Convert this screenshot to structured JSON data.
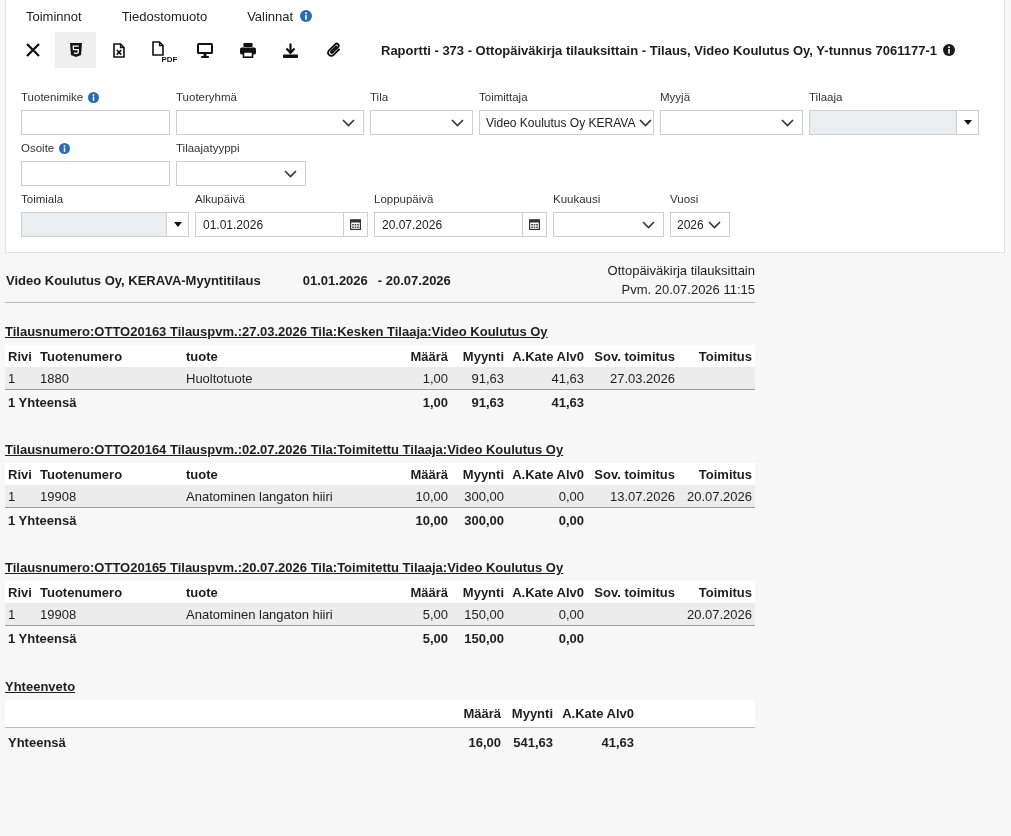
{
  "menu": [
    {
      "label": "Toiminnot",
      "info": false
    },
    {
      "label": "Tiedostomuoto",
      "info": false
    },
    {
      "label": "Valinnat",
      "info": true
    }
  ],
  "toolbar": [
    {
      "kind": "close",
      "selected": false
    },
    {
      "kind": "html",
      "selected": true
    },
    {
      "kind": "sheet",
      "selected": false
    },
    {
      "kind": "pdf",
      "label": "PDF",
      "selected": false
    },
    {
      "kind": "screen",
      "selected": false
    },
    {
      "kind": "print",
      "selected": false
    },
    {
      "kind": "download",
      "selected": false
    },
    {
      "kind": "attach",
      "selected": false
    }
  ],
  "report_title": {
    "text": "Raportti - 373 - Ottopäiväkirja tilauksittain - Tilaus, Video Koulutus Oy, Y-tunnus 7061177-1",
    "info": true
  },
  "filters": {
    "rows": [
      {
        "fields": [
          {
            "label": "Tuotenimike",
            "info": true,
            "kind": "text",
            "disabled": false
          },
          {
            "label": "Tuoteryhmä",
            "info": false,
            "kind": "select",
            "disabled": false
          },
          {
            "label": "Tila",
            "info": false,
            "kind": "select",
            "disabled": false
          },
          {
            "label": "Toimittaja",
            "info": false,
            "kind": "select",
            "value": "Video Koulutus Oy KERAVA",
            "disabled": false
          },
          {
            "label": "Myyjä",
            "info": false,
            "kind": "select",
            "disabled": false
          },
          {
            "label": "Tilaaja",
            "info": false,
            "kind": "combo",
            "disabled": true
          }
        ]
      },
      {
        "fields": [
          {
            "label": "Osoite",
            "info": true,
            "kind": "text",
            "disabled": false
          },
          {
            "label": "Tilaajatyyppi",
            "info": false,
            "kind": "select",
            "disabled": false
          }
        ]
      },
      {
        "fields": [
          {
            "label": "Toimiala",
            "info": false,
            "kind": "combo",
            "disabled": true
          },
          {
            "label": "Alkupäivä",
            "info": false,
            "kind": "date",
            "value": "01.01.2026",
            "disabled": false
          },
          {
            "label": "Loppupäivä",
            "info": false,
            "kind": "date",
            "value": "20.07.2026",
            "disabled": false
          },
          {
            "label": "Kuukausi",
            "info": false,
            "kind": "select",
            "disabled": false
          },
          {
            "label": "Vuosi",
            "info": false,
            "kind": "select",
            "value": "2026",
            "disabled": false
          }
        ]
      }
    ]
  },
  "report": {
    "company": "Video Koulutus Oy, KERAVA-Myyntitilaus",
    "period_start": "01.01.2026",
    "period_end": "- 20.07.2026",
    "report_name": "Ottopäiväkirja tilauksittain",
    "printed": "Pvm. 20.07.2026 11:15"
  },
  "orders": [
    {
      "title": "Tilausnumero:OTTO20163 Tilauspvm.:27.03.2026 Tila:Kesken Tilaaja:Video Koulutus Oy",
      "columns": [
        "Rivi",
        "Tuotenumero",
        "tuote",
        "Määrä",
        "Myynti",
        "A.Kate Alv0",
        "Sov. toimitus",
        "Toimitus"
      ],
      "rows": [
        {
          "rivi": "1",
          "tuotenumero": "1880",
          "tuote": "Huoltotuote",
          "maara": "1,00",
          "myynti": "91,63",
          "kate": "41,63",
          "sov_toimitus": "27.03.2026"
        }
      ],
      "total": {
        "label": "1 Yhteensä",
        "maara": "1,00",
        "myynti": "91,63",
        "kate": "41,63"
      }
    },
    {
      "title": "Tilausnumero:OTTO20164 Tilauspvm.:02.07.2026 Tila:Toimitettu Tilaaja:Video Koulutus Oy",
      "columns": [
        "Rivi",
        "Tuotenumero",
        "tuote",
        "Määrä",
        "Myynti",
        "A.Kate Alv0",
        "Sov. toimitus",
        "Toimitus"
      ],
      "rows": [
        {
          "rivi": "1",
          "tuotenumero": "19908",
          "tuote": "Anatominen langaton hiiri",
          "maara": "10,00",
          "myynti": "300,00",
          "kate": "0,00",
          "sov_toimitus": "13.07.2026",
          "toimitus": "20.07.2026"
        }
      ],
      "total": {
        "label": "1 Yhteensä",
        "maara": "10,00",
        "myynti": "300,00",
        "kate": "0,00"
      }
    },
    {
      "title": "Tilausnumero:OTTO20165 Tilauspvm.:20.07.2026 Tila:Toimitettu Tilaaja:Video Koulutus Oy",
      "columns": [
        "Rivi",
        "Tuotenumero",
        "tuote",
        "Määrä",
        "Myynti",
        "A.Kate Alv0",
        "Sov. toimitus",
        "Toimitus"
      ],
      "rows": [
        {
          "rivi": "1",
          "tuotenumero": "19908",
          "tuote": "Anatominen langaton hiiri",
          "maara": "5,00",
          "myynti": "150,00",
          "kate": "0,00",
          "toimitus": "20.07.2026"
        }
      ],
      "total": {
        "label": "1 Yhteensä",
        "maara": "5,00",
        "myynti": "150,00",
        "kate": "0,00"
      }
    }
  ],
  "summary": {
    "title": "Yhteenveto",
    "columns": [
      "Määrä",
      "Myynti",
      "A.Kate Alv0"
    ],
    "total": {
      "label": "Yhteensä",
      "maara": "16,00",
      "myynti": "541,63",
      "kate": "41,63"
    }
  }
}
